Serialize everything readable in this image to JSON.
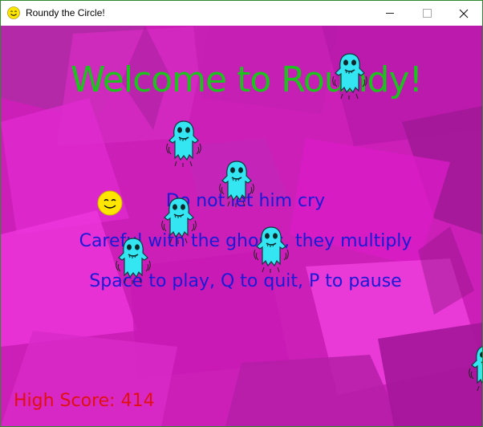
{
  "window": {
    "title": "Roundy the Circle!",
    "controls": [
      "minimize",
      "maximize",
      "close"
    ]
  },
  "game": {
    "welcome": "Welcome to Roundy!",
    "instructions": [
      "Do not let him cry",
      "Careful with the ghosts, they multiply",
      "Space to play, Q to quit, P to pause"
    ],
    "high_score_label": "High Score:",
    "high_score_value": 414,
    "high_score_text": "High Score: 414",
    "ghost_count": 7
  },
  "colors": {
    "background": "#cc1fb8",
    "title": "#1ec21e",
    "instructions": "#1a1ad6",
    "high_score": "#e01010",
    "ghost": "#33e6f2",
    "player": "#ffe600"
  },
  "icons": {
    "app": "smiley-icon",
    "player": "roundy-smiley",
    "enemy": "ghost-icon"
  }
}
